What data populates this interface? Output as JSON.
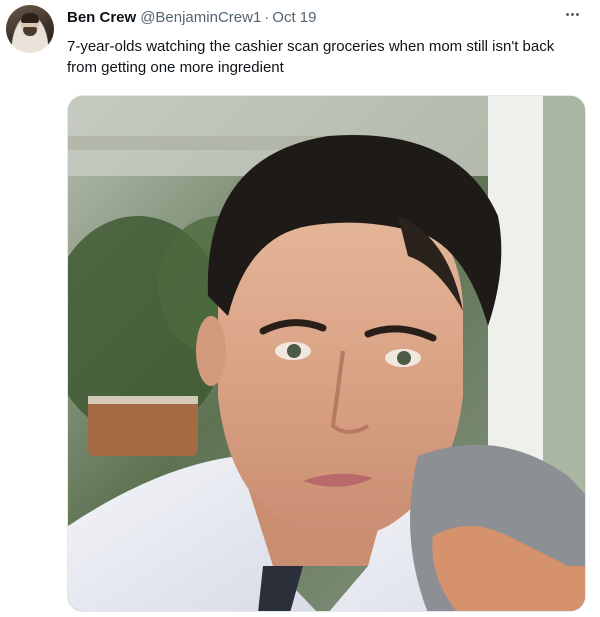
{
  "tweet": {
    "author_name": "Ben Crew",
    "handle": "@BenjaminCrew1",
    "separator": "·",
    "date": "Oct 19",
    "text": "7-year-olds watching the cashier scan groceries when mom still isn't back from getting one more ingredient"
  },
  "icons": {
    "more": "more-horizontal-icon"
  },
  "colors": {
    "name": "#0f1419",
    "secondary": "#536471",
    "background": "#ffffff"
  }
}
